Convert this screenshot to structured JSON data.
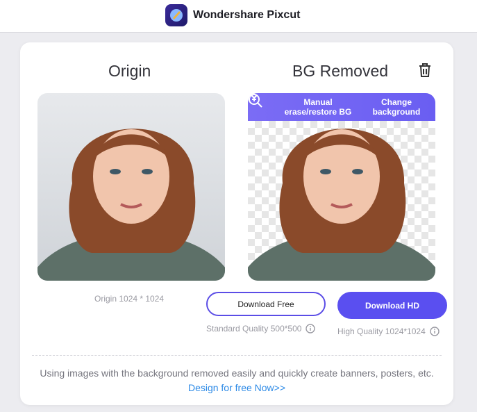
{
  "app": {
    "name": "Wondershare Pixcut"
  },
  "panels": {
    "origin_title": "Origin",
    "removed_title": "BG Removed"
  },
  "toolbar": {
    "manual_erase_label": "Manual erase/restore BG",
    "change_bg_label": "Change background"
  },
  "origin_meta": "Origin 1024 * 1024",
  "downloads": {
    "free_label": "Download Free",
    "free_quality": "Standard Quality 500*500",
    "hd_label": "Download HD",
    "hd_quality": "High Quality 1024*1024"
  },
  "footer": {
    "text": "Using images with the background removed easily and quickly create banners, posters, etc.",
    "link": "Design for free Now>>"
  },
  "colors": {
    "accent": "#5a4ff0",
    "toolbar": "#6f62f3",
    "link": "#2d8ae6"
  },
  "icons": [
    "app-logo-icon",
    "trash-icon",
    "zoom-in-icon",
    "chevron-down-icon",
    "info-icon"
  ]
}
